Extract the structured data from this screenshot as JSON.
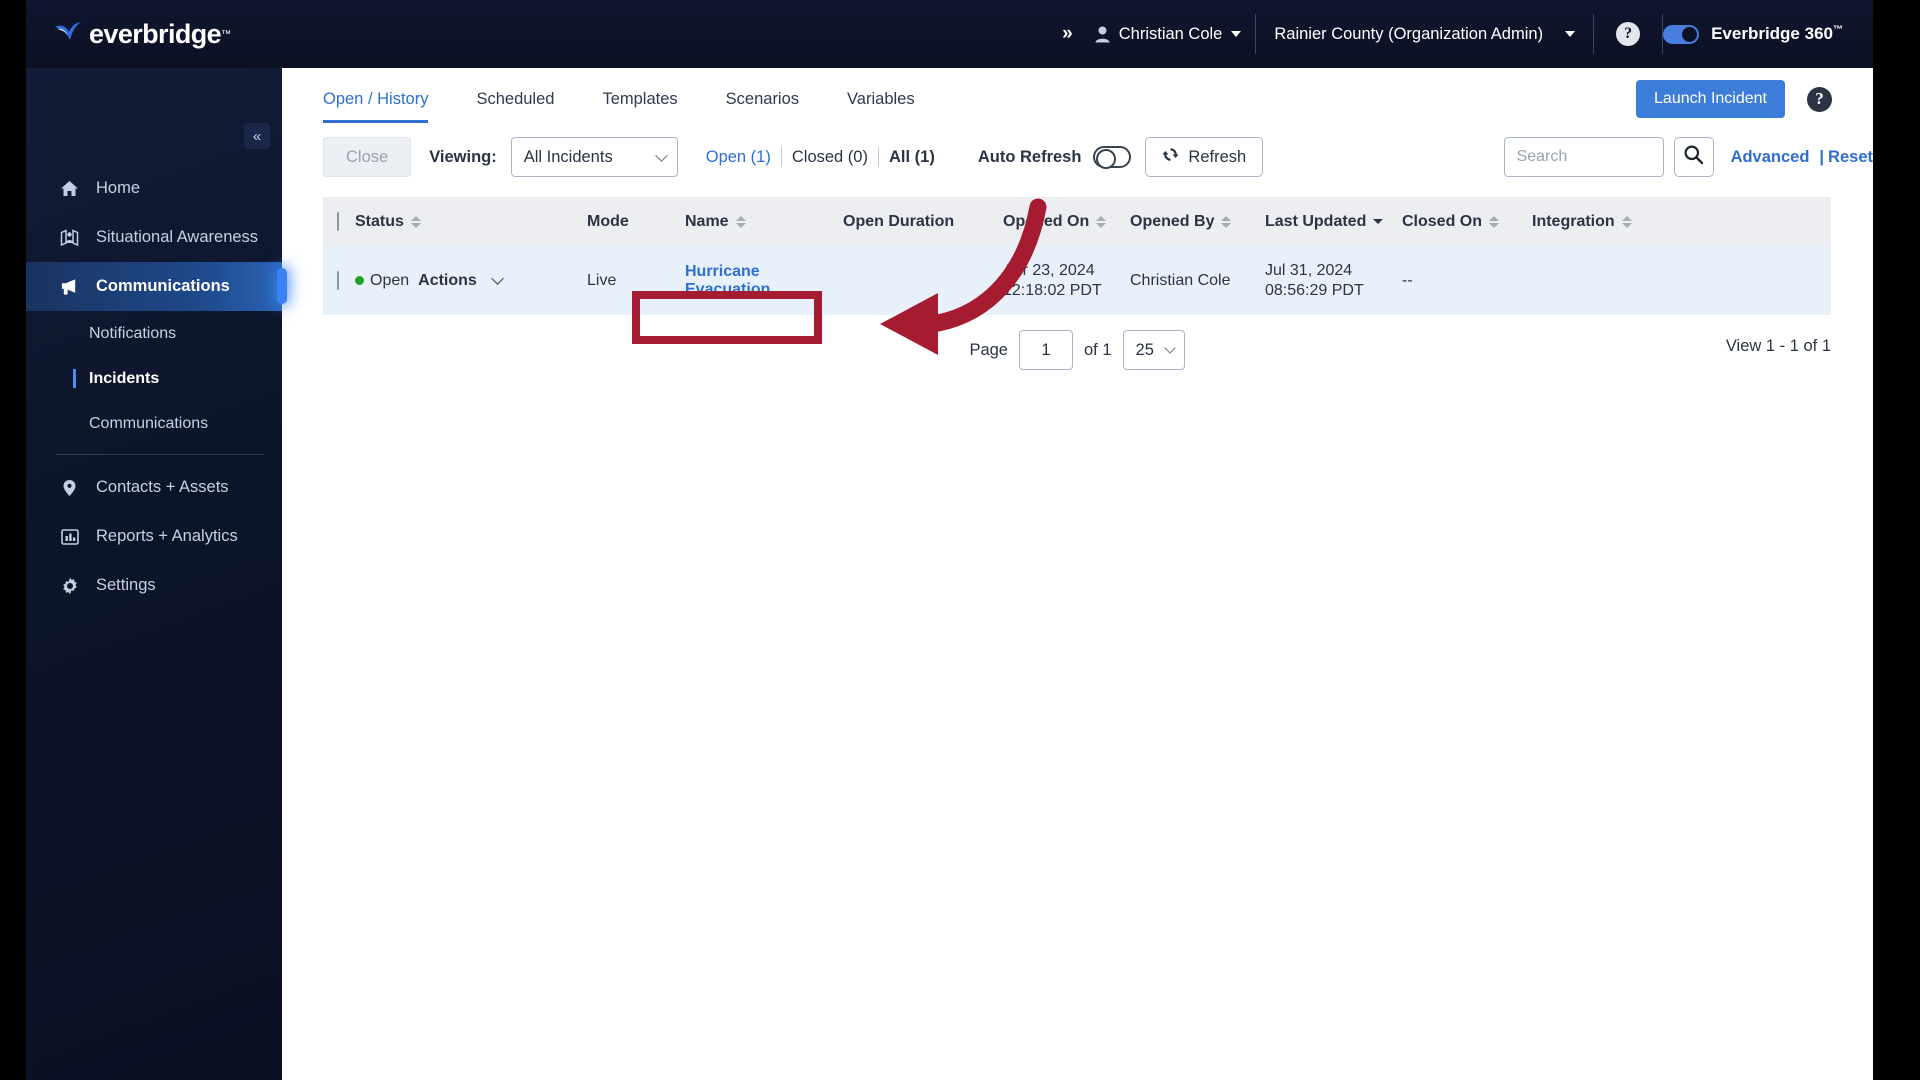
{
  "header": {
    "logo_text": "everbridge",
    "logo_tm": "™",
    "expand_icon": "»",
    "user_name": "Christian Cole",
    "org_name": "Rainier County (Organization Admin)",
    "help_label": "?",
    "eb360_label_main": "Everbridge ",
    "eb360_label_bold": "360",
    "eb360_tm": "™",
    "toggle_state": "on",
    "accent_color": "#4a7de0",
    "bg_color": "#0d1226"
  },
  "sidebar": {
    "collapse_icon": "«",
    "items": [
      {
        "label": "Home",
        "icon": "home-icon",
        "active": false
      },
      {
        "label": "Situational Awareness",
        "icon": "map-pin-person-icon",
        "active": false
      },
      {
        "label": "Communications",
        "icon": "megaphone-icon",
        "active": true
      },
      {
        "label": "Contacts + Assets",
        "icon": "location-pin-icon",
        "active": false
      },
      {
        "label": "Reports + Analytics",
        "icon": "bar-chart-icon",
        "active": false
      },
      {
        "label": "Settings",
        "icon": "gear-icon",
        "active": false
      }
    ],
    "sub_items": [
      {
        "label": "Notifications",
        "active": false
      },
      {
        "label": "Incidents",
        "active": true
      },
      {
        "label": "Communications",
        "active": false
      }
    ]
  },
  "tabs": [
    {
      "label": "Open / History",
      "active": true
    },
    {
      "label": "Scheduled",
      "active": false
    },
    {
      "label": "Templates",
      "active": false
    },
    {
      "label": "Scenarios",
      "active": false
    },
    {
      "label": "Variables",
      "active": false
    }
  ],
  "tabs_right": {
    "launch_incident_label": "Launch Incident",
    "help_label": "?"
  },
  "toolbar": {
    "close_label": "Close",
    "viewing_label": "Viewing:",
    "viewing_value": "All Incidents",
    "filter_open": "Open (1)",
    "filter_closed": "Closed (0)",
    "filter_all": "All (1)",
    "auto_refresh_label": "Auto Refresh",
    "auto_refresh_state": "off",
    "refresh_label": "Refresh",
    "search_placeholder": "Search",
    "search_value": "",
    "advanced_label": "Advanced",
    "separator": "|",
    "reset_label": "Reset"
  },
  "table": {
    "columns": [
      {
        "label": "Status",
        "sortable": true,
        "sort": "none"
      },
      {
        "label": "Mode",
        "sortable": false,
        "sort": "none"
      },
      {
        "label": "Name",
        "sortable": true,
        "sort": "none"
      },
      {
        "label": "Open Duration",
        "sortable": false,
        "sort": "none"
      },
      {
        "label": "Opened On",
        "sortable": true,
        "sort": "none"
      },
      {
        "label": "Opened By",
        "sortable": true,
        "sort": "none"
      },
      {
        "label": "Last Updated",
        "sortable": true,
        "sort": "desc"
      },
      {
        "label": "Closed On",
        "sortable": true,
        "sort": "none"
      },
      {
        "label": "Integration",
        "sortable": true,
        "sort": "none"
      }
    ],
    "rows": [
      {
        "status": "Open",
        "actions_label": "Actions",
        "mode": "Live",
        "name": "Hurricane Evacuation",
        "open_duration": "",
        "opened_on": "Apr 23, 2024 12:18:02 PDT",
        "opened_by": "Christian Cole",
        "last_updated": "Jul 31, 2024 08:56:29 PDT",
        "closed_on": "--",
        "integration": ""
      }
    ]
  },
  "pagination": {
    "page_label": "Page",
    "page_value": "1",
    "of_label": "of 1",
    "page_size": "25",
    "view_count": "View 1 - 1 of 1"
  },
  "annotation": {
    "highlight_color": "#a51c30",
    "arrow_color": "#a51c30",
    "target": "Hurricane Evacuation"
  }
}
